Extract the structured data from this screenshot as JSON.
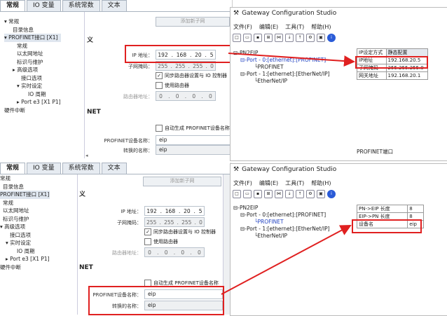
{
  "top": {
    "tabs": [
      "常规",
      "IO 变量",
      "系统常数",
      "文本"
    ],
    "add_subnet_button": "添加新子网",
    "nav": [
      "常规",
      "目录信息",
      "PROFINET接口 [X1]",
      "常规",
      "以太网地址",
      "标识与维护",
      "▸ 高级选项",
      "接口选项",
      "▾ 实时设定",
      "IO 周期",
      "▸ Port e3 [X1 P1]",
      "硬件中断"
    ],
    "section_prefix": "义",
    "ip_label": "IP 地址：",
    "ip_octets": [
      "192",
      "168",
      "20",
      "5"
    ],
    "mask_label": "子网掩码：",
    "mask_octets": [
      "255",
      "255",
      "255",
      "0"
    ],
    "sync_router": "同步路由器设置与 IO 控制器",
    "use_router": "使用路由器",
    "router_label": "路由器地址：",
    "router_octets": [
      "0",
      "0",
      "0",
      "0"
    ],
    "section_net": "NET",
    "auto_name": "自动生成 PROFINET设备名称",
    "device_name_label": "PROFINET设备名称：",
    "device_name": "eip",
    "converted_label": "转换的名称：",
    "converted_name": "eip"
  },
  "bottom": {
    "tabs": [
      "常规",
      "IO 变量",
      "系统常数",
      "文本"
    ],
    "add_subnet_button": "添加新子网",
    "nav": [
      "常规",
      "目录信息",
      "PROFINET接口 [X1]",
      "常规",
      "以太网地址",
      "标识与维护",
      "▾ 高级选项",
      "接口选项",
      "▾ 实时设定",
      "IO 周期",
      "▸ Port e3 [X1 P1]",
      "硬件中断"
    ],
    "section_prefix": "义",
    "ip_label": "IP 地址：",
    "ip_octets": [
      "192",
      "168",
      "20",
      "5"
    ],
    "mask_label": "子网掩码：",
    "mask_octets": [
      "255",
      "255",
      "255",
      "0"
    ],
    "sync_router": "同步路由器设置与 IO 控制器",
    "use_router": "使用路由器",
    "router_label": "路由器地址：",
    "router_octets": [
      "0",
      "0",
      "0",
      "0"
    ],
    "section_net": "NET",
    "auto_name": "自动生成 PROFINET设备名称",
    "device_name_label": "PROFINET设备名称：",
    "device_name": "eip",
    "converted_label": "转换的名称：",
    "converted_name": "eip"
  },
  "gw_top": {
    "title": "Gateway Configuration Studio",
    "menu": [
      "文件(F)",
      "编辑(E)",
      "工具(T)",
      "帮助(H)"
    ],
    "tree": [
      "⊟-PN2EIP",
      "⊟-Port - 0:[ethernet]:[PROFINET]",
      "└PROFINET",
      "⊟-Port - 1:[ethernet]:[EtherNet/IP]",
      "└EtherNet/IP"
    ],
    "grid_rows": [
      [
        "IP设定方式",
        "静态配置"
      ],
      [
        "IP地址",
        "192.168.20.5"
      ],
      [
        "子网掩码",
        "255.255.255.0"
      ],
      [
        "网关地址",
        "192.168.20.1"
      ]
    ],
    "footer": "PROFINET端口"
  },
  "gw_bottom": {
    "title": "Gateway Configuration Studio",
    "menu": [
      "文件(F)",
      "编辑(E)",
      "工具(T)",
      "帮助(H)"
    ],
    "tree": [
      "⊟-PN2EIP",
      "⊟-Port - 0:[ethernet]:[PROFINET]",
      "└PROFINET",
      "⊟-Port - 1:[ethernet]:[EtherNet/IP]",
      "└EtherNet/IP"
    ],
    "grid_rows": [
      [
        "PN->EIP 长度",
        "8"
      ],
      [
        "EIP->PN 长度",
        "8"
      ],
      [
        "设备名",
        "eip"
      ]
    ]
  },
  "colors": {
    "highlight": "#e02020",
    "accent": "#1e3fc0"
  }
}
